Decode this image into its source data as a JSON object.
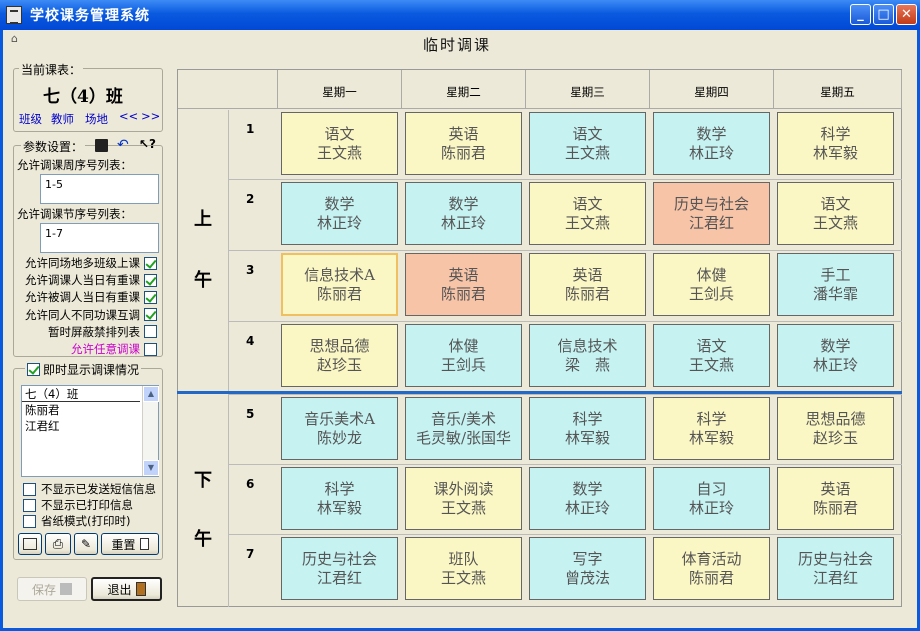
{
  "window": {
    "title": "学校课务管理系统",
    "buttons": {
      "minimize": "_",
      "maximize": "□",
      "close": "✕"
    }
  },
  "heading": "临时调课",
  "current_table": {
    "label": "当前课表：",
    "class_name": "七（4）班",
    "links": [
      "班级",
      "教师",
      "场地"
    ],
    "prev": "<<",
    "next": ">>"
  },
  "params": {
    "label": "参数设置：",
    "week_list_label": "允许调课周序号列表：",
    "week_list_value": "1-5",
    "period_list_label": "允许调课节序号列表：",
    "period_list_value": "1-7",
    "options": [
      {
        "label": "允许同场地多班级上课",
        "checked": true,
        "color": "#000000"
      },
      {
        "label": "允许调课人当日有重课",
        "checked": true,
        "color": "#000000"
      },
      {
        "label": "允许被调人当日有重课",
        "checked": true,
        "color": "#000000"
      },
      {
        "label": "允许同人不同功课互调",
        "checked": true,
        "color": "#000000"
      },
      {
        "label": "暂时屏蔽禁排列表",
        "checked": false,
        "color": "#000000"
      },
      {
        "label": "允许任意调课",
        "checked": false,
        "color": "#cc00cc"
      }
    ]
  },
  "live": {
    "label": "即时显示调课情况",
    "checked": true,
    "items": [
      "七（4）班",
      "陈丽君",
      "江君红"
    ],
    "options": [
      {
        "label": "不显示已发送短信信息",
        "checked": false
      },
      {
        "label": "不显示已打印信息",
        "checked": false
      },
      {
        "label": "省纸模式(打印时)",
        "checked": false
      }
    ],
    "reset_label": "重置"
  },
  "footer": {
    "save_label": "保存",
    "exit_label": "退出"
  },
  "timetable": {
    "days": [
      "星期一",
      "星期二",
      "星期三",
      "星期四",
      "星期五"
    ],
    "am_label": [
      "上",
      "午"
    ],
    "pm_label": [
      "下",
      "午"
    ],
    "periods": [
      "1",
      "2",
      "3",
      "4",
      "5",
      "6",
      "7"
    ],
    "rows": [
      [
        {
          "s": "语文",
          "t": "王文燕",
          "c": "yellow"
        },
        {
          "s": "英语",
          "t": "陈丽君",
          "c": "yellow"
        },
        {
          "s": "语文",
          "t": "王文燕",
          "c": "cyan"
        },
        {
          "s": "数学",
          "t": "林正玲",
          "c": "cyan"
        },
        {
          "s": "科学",
          "t": "林军毅",
          "c": "yellow"
        }
      ],
      [
        {
          "s": "数学",
          "t": "林正玲",
          "c": "cyan"
        },
        {
          "s": "数学",
          "t": "林正玲",
          "c": "cyan"
        },
        {
          "s": "语文",
          "t": "王文燕",
          "c": "yellow"
        },
        {
          "s": "历史与社会",
          "t": "江君红",
          "c": "salmon"
        },
        {
          "s": "语文",
          "t": "王文燕",
          "c": "yellow"
        }
      ],
      [
        {
          "s": "信息技术A",
          "t": "陈丽君",
          "c": "yellow",
          "sel": true
        },
        {
          "s": "英语",
          "t": "陈丽君",
          "c": "salmon"
        },
        {
          "s": "英语",
          "t": "陈丽君",
          "c": "yellow"
        },
        {
          "s": "体健",
          "t": "王剑兵",
          "c": "yellow"
        },
        {
          "s": "手工",
          "t": "潘华霏",
          "c": "cyan"
        }
      ],
      [
        {
          "s": "思想品德",
          "t": "赵珍玉",
          "c": "yellow"
        },
        {
          "s": "体健",
          "t": "王剑兵",
          "c": "cyan"
        },
        {
          "s": "信息技术",
          "t": "梁　燕",
          "c": "cyan"
        },
        {
          "s": "语文",
          "t": "王文燕",
          "c": "cyan"
        },
        {
          "s": "数学",
          "t": "林正玲",
          "c": "cyan"
        }
      ],
      [
        {
          "s": "音乐美术A",
          "t": "陈妙龙",
          "c": "cyan"
        },
        {
          "s": "音乐/美术",
          "t": "毛灵敏/张国华",
          "c": "cyan"
        },
        {
          "s": "科学",
          "t": "林军毅",
          "c": "cyan"
        },
        {
          "s": "科学",
          "t": "林军毅",
          "c": "yellow"
        },
        {
          "s": "思想品德",
          "t": "赵珍玉",
          "c": "yellow"
        }
      ],
      [
        {
          "s": "科学",
          "t": "林军毅",
          "c": "cyan"
        },
        {
          "s": "课外阅读",
          "t": "王文燕",
          "c": "yellow"
        },
        {
          "s": "数学",
          "t": "林正玲",
          "c": "cyan"
        },
        {
          "s": "自习",
          "t": "林正玲",
          "c": "cyan"
        },
        {
          "s": "英语",
          "t": "陈丽君",
          "c": "yellow"
        }
      ],
      [
        {
          "s": "历史与社会",
          "t": "江君红",
          "c": "cyan"
        },
        {
          "s": "班队",
          "t": "王文燕",
          "c": "yellow"
        },
        {
          "s": "写字",
          "t": "曾茂法",
          "c": "cyan"
        },
        {
          "s": "体育活动",
          "t": "陈丽君",
          "c": "yellow"
        },
        {
          "s": "历史与社会",
          "t": "江君红",
          "c": "cyan"
        }
      ]
    ]
  }
}
